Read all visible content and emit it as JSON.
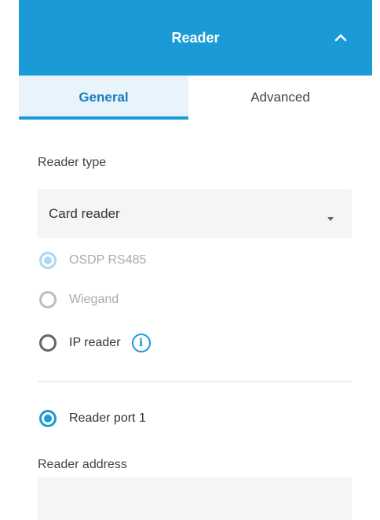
{
  "panel": {
    "title": "Reader",
    "collapse_icon": "chevron-up-icon"
  },
  "tabs": [
    {
      "label": "General",
      "active": true
    },
    {
      "label": "Advanced",
      "active": false
    }
  ],
  "reader_type": {
    "label": "Reader type",
    "selected": "Card reader",
    "options": [
      {
        "label": "OSDP RS485",
        "checked": true,
        "disabled": true
      },
      {
        "label": "Wiegand",
        "checked": false,
        "disabled": true
      },
      {
        "label": "IP reader",
        "checked": false,
        "disabled": false
      }
    ]
  },
  "reader_port": {
    "label": "Reader port 1",
    "checked": true
  },
  "reader_address": {
    "label": "Reader address",
    "value": "",
    "placeholder": ""
  },
  "colors": {
    "accent": "#1a9ad7",
    "accent_dark": "#1a7ec0",
    "disabled_checked": "#a8d9ef",
    "disabled_unchecked": "#bdbdbd"
  }
}
